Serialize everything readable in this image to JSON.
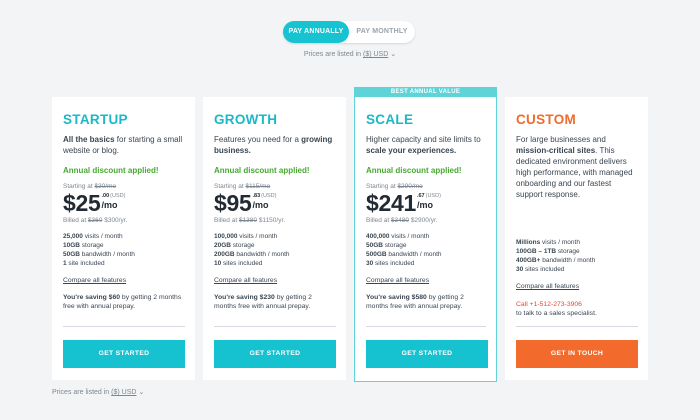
{
  "billing_toggle": {
    "annual": "PAY ANNUALLY",
    "monthly": "PAY MONTHLY"
  },
  "currency_note": {
    "prefix": "Prices are listed in",
    "currency": "($) USD"
  },
  "plans": {
    "startup": {
      "name": "STARTUP",
      "desc_bold": "All the basics",
      "desc_rest": " for starting a small website or blog.",
      "discount": "Annual discount applied!",
      "starting_prefix": "Starting at ",
      "starting_old": "$30/mo",
      "price_main": "$25",
      "cents": ".00",
      "usd": "(USD)",
      "per": "/mo",
      "billed_prefix": "Billed at ",
      "billed_old": "$360",
      "billed_new": " $300/yr.",
      "features": [
        {
          "bold": "25,000",
          "rest": " visits / month"
        },
        {
          "bold": "10GB",
          "rest": " storage"
        },
        {
          "bold": "50GB",
          "rest": " bandwidth / month"
        },
        {
          "bold": "1",
          "rest": " site included"
        }
      ],
      "compare": "Compare all features",
      "saving_bold": "You're saving $60",
      "saving_rest": " by getting 2 months free with annual prepay.",
      "cta": "GET STARTED"
    },
    "growth": {
      "name": "GROWTH",
      "desc_pre": "Features you need for a ",
      "desc_bold": "growing business.",
      "discount": "Annual discount applied!",
      "starting_prefix": "Starting at ",
      "starting_old": "$115/mo",
      "price_main": "$95",
      "cents": ".83",
      "usd": "(USD)",
      "per": "/mo",
      "billed_prefix": "Billed at ",
      "billed_old": "$1380",
      "billed_new": " $1150/yr.",
      "features": [
        {
          "bold": "100,000",
          "rest": " visits / month"
        },
        {
          "bold": "20GB",
          "rest": " storage"
        },
        {
          "bold": "200GB",
          "rest": " bandwidth / month"
        },
        {
          "bold": "10",
          "rest": " sites included"
        }
      ],
      "compare": "Compare all features",
      "saving_bold": "You're saving $230",
      "saving_rest": " by getting 2 months free with annual prepay.",
      "cta": "GET STARTED"
    },
    "scale": {
      "badge": "BEST ANNUAL VALUE",
      "name": "SCALE",
      "desc_pre": "Higher capacity and site limits to ",
      "desc_bold": "scale your experiences.",
      "discount": "Annual discount applied!",
      "starting_prefix": "Starting at ",
      "starting_old": "$290/mo",
      "price_main": "$241",
      "cents": ".67",
      "usd": "(USD)",
      "per": "/mo",
      "billed_prefix": "Billed at ",
      "billed_old": "$3480",
      "billed_new": " $2900/yr.",
      "features": [
        {
          "bold": "400,000",
          "rest": " visits / month"
        },
        {
          "bold": "50GB",
          "rest": " storage"
        },
        {
          "bold": "500GB",
          "rest": " bandwidth / month"
        },
        {
          "bold": "30",
          "rest": " sites included"
        }
      ],
      "compare": "Compare all features",
      "saving_bold": "You're saving $580",
      "saving_rest": " by getting 2 months free with annual prepay.",
      "cta": "GET STARTED"
    },
    "custom": {
      "name": "CUSTOM",
      "desc_pre": "For large businesses and ",
      "desc_bold": "mission-critical sites",
      "desc_rest": ". This dedicated environment delivers high performance, with managed onboarding and our fastest support response.",
      "features": [
        {
          "bold": "Millions",
          "rest": " visits / month"
        },
        {
          "bold": "100GB – 1TB",
          "rest": " storage"
        },
        {
          "bold": "400GB+",
          "rest": " bandwidth / month"
        },
        {
          "bold": "30",
          "rest": " sites included"
        }
      ],
      "compare": "Compare all features",
      "call_phone": "Call +1-512-273-3906",
      "call_rest": "to talk to a sales specialist.",
      "cta": "GET IN TOUCH"
    }
  },
  "colors": {
    "teal": "#16c2cf",
    "orange": "#f26b2c",
    "green": "#48a832",
    "badge": "#5ed3d8"
  }
}
